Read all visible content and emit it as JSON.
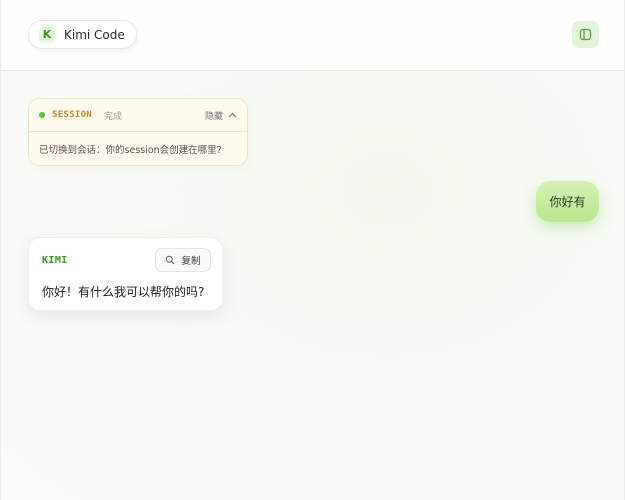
{
  "header": {
    "brand_letter": "K",
    "brand_name": "Kimi Code",
    "sidebar_toggle_icon": "sidebar-panel-icon"
  },
  "session": {
    "tag": "SESSION",
    "status": "完成",
    "hide_label": "隐藏",
    "hide_icon": "chevron-up-icon",
    "message": "已切换到会话：你的session会创建在哪里?",
    "status_color": "#5cc03a"
  },
  "user_message": {
    "text": "你好有"
  },
  "assistant_message": {
    "label": "KIMI",
    "copy_label": "复制",
    "copy_icon": "search-icon",
    "text": "你好！有什么我可以帮你的吗?"
  },
  "colors": {
    "accent": "#3a9a1c",
    "session_accent": "#c98a1d",
    "user_bubble": "#c6ec9f"
  }
}
